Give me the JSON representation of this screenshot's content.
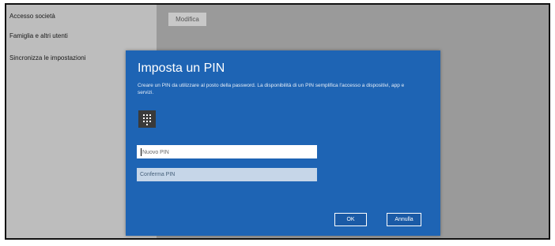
{
  "sidebar": {
    "items": [
      {
        "label": "Accesso società"
      },
      {
        "label": "Famiglia e altri utenti"
      },
      {
        "label": "Sincronizza le impostazioni"
      }
    ]
  },
  "content": {
    "edit_button_label": "Modifica"
  },
  "dialog": {
    "title": "Imposta un PIN",
    "description": "Creare un PIN da utilizzare al posto della password. La disponibilità di un PIN semplifica l'accesso a dispositivi, app e servizi.",
    "pin_icon": "keypad-icon",
    "new_pin_placeholder": "Nuovo PIN",
    "confirm_pin_placeholder": "Conferma PIN",
    "ok_label": "OK",
    "cancel_label": "Annulla"
  },
  "colors": {
    "dialog_background": "#1e64b4",
    "dim_overlay": "#8a8a8a"
  }
}
